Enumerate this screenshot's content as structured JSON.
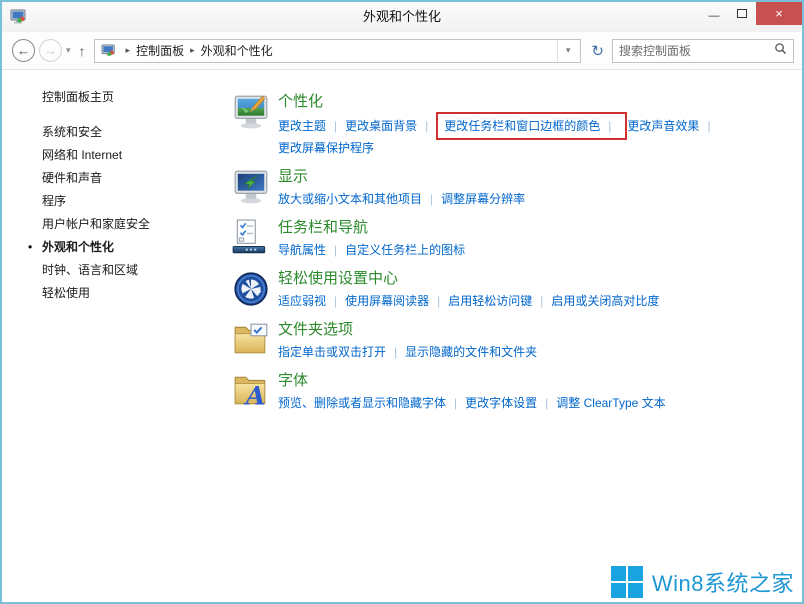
{
  "window": {
    "title": "外观和个性化"
  },
  "glyphs": {
    "back": "←",
    "forward": "→",
    "caret": "▾",
    "up": "↑",
    "breadcrumb_sep": "▸",
    "dropdown": "▾",
    "refresh": "↻",
    "minimize": "—",
    "close": "×",
    "active_bullet": "•"
  },
  "navbar": {
    "breadcrumb": {
      "root": "控制面板",
      "current": "外观和个性化"
    },
    "search": {
      "placeholder": "搜索控制面板"
    }
  },
  "sidebar": {
    "home": "控制面板主页",
    "items": [
      {
        "label": "系统和安全"
      },
      {
        "label": "网络和 Internet"
      },
      {
        "label": "硬件和声音"
      },
      {
        "label": "程序"
      },
      {
        "label": "用户帐户和家庭安全"
      },
      {
        "label": "外观和个性化",
        "active": true
      },
      {
        "label": "时钟、语言和区域"
      },
      {
        "label": "轻松使用"
      }
    ]
  },
  "sections": [
    {
      "title": "个性化",
      "icon": "personalization-icon",
      "links": [
        {
          "label": "更改主题"
        },
        {
          "label": "更改桌面背景"
        },
        {
          "label": "更改任务栏和窗口边框的颜色",
          "highlighted": true
        },
        {
          "label": "更改声音效果"
        },
        {
          "label": "更改屏幕保护程序"
        }
      ]
    },
    {
      "title": "显示",
      "icon": "display-icon",
      "links": [
        {
          "label": "放大或缩小文本和其他项目"
        },
        {
          "label": "调整屏幕分辨率"
        }
      ]
    },
    {
      "title": "任务栏和导航",
      "icon": "taskbar-icon",
      "links": [
        {
          "label": "导航属性"
        },
        {
          "label": "自定义任务栏上的图标"
        }
      ]
    },
    {
      "title": "轻松使用设置中心",
      "icon": "ease-of-access-icon",
      "links": [
        {
          "label": "适应弱视"
        },
        {
          "label": "使用屏幕阅读器"
        },
        {
          "label": "启用轻松访问键"
        },
        {
          "label": "启用或关闭高对比度"
        }
      ]
    },
    {
      "title": "文件夹选项",
      "icon": "folder-options-icon",
      "links": [
        {
          "label": "指定单击或双击打开"
        },
        {
          "label": "显示隐藏的文件和文件夹"
        }
      ]
    },
    {
      "title": "字体",
      "icon": "fonts-icon",
      "links": [
        {
          "label": "预览、删除或者显示和隐藏字体"
        },
        {
          "label": "更改字体设置"
        },
        {
          "label": "调整 ClearType 文本"
        }
      ]
    }
  ],
  "watermark": {
    "text": "Win8系统之家"
  },
  "colors": {
    "link": "#0066cc",
    "heading_green": "#2c8a2c",
    "highlight_red": "#d03030",
    "window_border": "#79c0d8",
    "close_button_red": "#c75050",
    "watermark_blue": "#1f97d4",
    "logo_blue": "#19a3e1"
  }
}
